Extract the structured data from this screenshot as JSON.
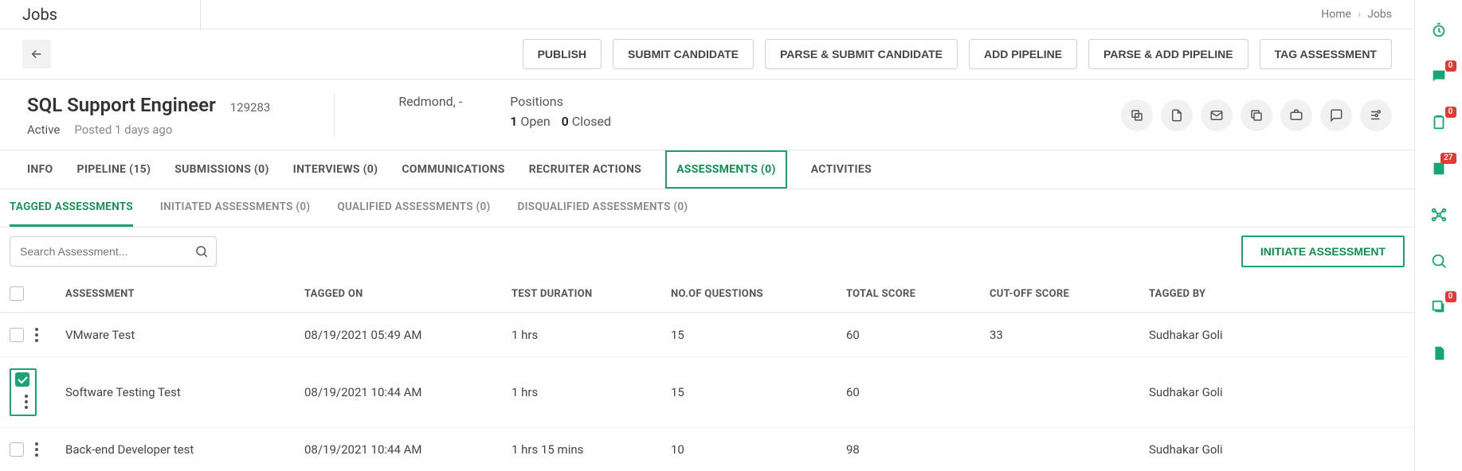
{
  "breadcrumb": {
    "home": "Home",
    "current": "Jobs"
  },
  "page_heading": "Jobs",
  "actions": {
    "publish": "PUBLISH",
    "submit_candidate": "SUBMIT CANDIDATE",
    "parse_submit_candidate": "PARSE & SUBMIT CANDIDATE",
    "add_pipeline": "ADD PIPELINE",
    "parse_add_pipeline": "PARSE & ADD PIPELINE",
    "tag_assessment": "TAG ASSESSMENT"
  },
  "job": {
    "title": "SQL Support Engineer",
    "id": "129283",
    "status": "Active",
    "posted": "Posted 1 days ago",
    "location": "Redmond, -",
    "positions_label": "Positions",
    "open_count": "1",
    "open_label": "Open",
    "closed_count": "0",
    "closed_label": "Closed"
  },
  "tabs_primary": [
    {
      "label": "INFO"
    },
    {
      "label": "PIPELINE (15)"
    },
    {
      "label": "SUBMISSIONS (0)"
    },
    {
      "label": "INTERVIEWS (0)"
    },
    {
      "label": "COMMUNICATIONS"
    },
    {
      "label": "RECRUITER ACTIONS"
    },
    {
      "label": "ASSESSMENTS (0)"
    },
    {
      "label": "ACTIVITIES"
    }
  ],
  "tabs_secondary": [
    {
      "label": "TAGGED ASSESSMENTS"
    },
    {
      "label": "INITIATED ASSESSMENTS (0)"
    },
    {
      "label": "QUALIFIED ASSESSMENTS (0)"
    },
    {
      "label": "DISQUALIFIED ASSESSMENTS (0)"
    }
  ],
  "search": {
    "placeholder": "Search Assessment..."
  },
  "initiate_label": "INITIATE ASSESSMENT",
  "table": {
    "headers": {
      "assessment": "ASSESSMENT",
      "tagged_on": "TAGGED ON",
      "test_duration": "TEST DURATION",
      "no_of_questions": "NO.OF QUESTIONS",
      "total_score": "TOTAL SCORE",
      "cutoff_score": "CUT-OFF SCORE",
      "tagged_by": "TAGGED BY"
    },
    "rows": [
      {
        "checked": false,
        "assessment": "VMware Test",
        "tagged_on": "08/19/2021 05:49 AM",
        "test_duration": "1 hrs",
        "no_of_questions": "15",
        "total_score": "60",
        "cutoff_score": "33",
        "tagged_by": "Sudhakar Goli"
      },
      {
        "checked": true,
        "assessment": "Software Testing Test",
        "tagged_on": "08/19/2021 10:44 AM",
        "test_duration": "1 hrs",
        "no_of_questions": "15",
        "total_score": "60",
        "cutoff_score": "",
        "tagged_by": "Sudhakar Goli"
      },
      {
        "checked": false,
        "assessment": "Back-end Developer test",
        "tagged_on": "08/19/2021 10:44 AM",
        "test_duration": "1 hrs 15 mins",
        "no_of_questions": "10",
        "total_score": "98",
        "cutoff_score": "",
        "tagged_by": "Sudhakar Goli"
      }
    ]
  },
  "right_badges": {
    "b1": "0",
    "b2": "0",
    "b3": "27",
    "b4": "0"
  }
}
